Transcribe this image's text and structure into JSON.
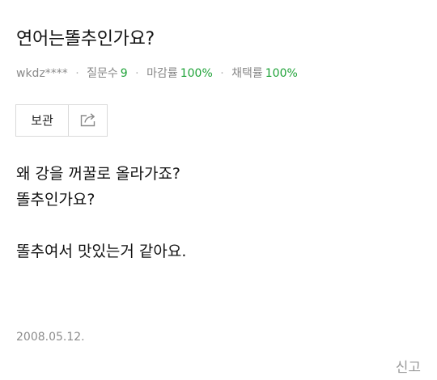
{
  "question": {
    "title": "연어는똘추인가요?",
    "author": "wkdz****",
    "stats": [
      {
        "label": "질문수",
        "value": "9"
      },
      {
        "label": "마감률",
        "value": "100%"
      },
      {
        "label": "채택률",
        "value": "100%"
      }
    ],
    "body_lines": [
      "왜 강을 꺼꿀로 올라가죠?",
      "똘추인가요?",
      "",
      "똘추여서 맛있는거 같아요."
    ],
    "date": "2008.05.12."
  },
  "actions": {
    "save_label": "보관",
    "share_icon": "share-icon"
  },
  "footer": {
    "report_label": "신고"
  },
  "colors": {
    "accent_green": "#20a339",
    "muted": "#888888",
    "border": "#d9d9d9"
  }
}
